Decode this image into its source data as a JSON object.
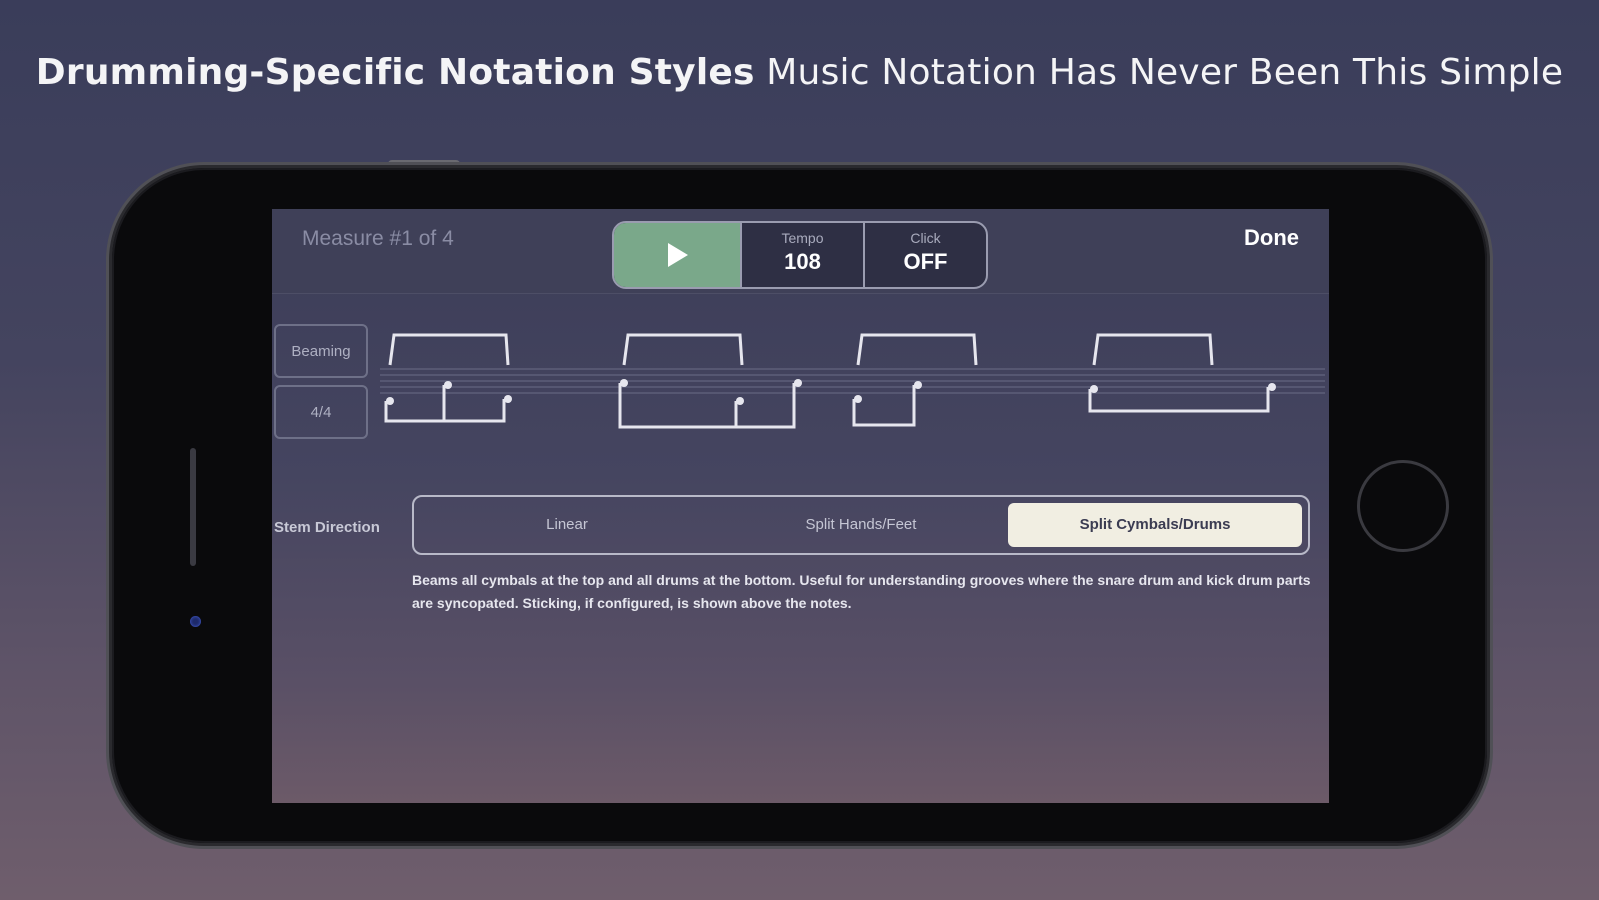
{
  "headline": {
    "bold": "Drumming-Specific Notation Styles",
    "rest": "Music Notation Has Never Been This Simple"
  },
  "app": {
    "measure_label": "Measure #1 of 4",
    "done_label": "Done",
    "transport": {
      "play_icon": "play-icon",
      "tempo_label": "Tempo",
      "tempo_value": "108",
      "click_label": "Click",
      "click_value": "OFF"
    },
    "side_buttons": {
      "beaming": "Beaming",
      "time_signature": "4/4"
    },
    "stem_direction": {
      "label": "Stem Direction",
      "options": [
        "Linear",
        "Split Hands/Feet",
        "Split Cymbals/Drums"
      ],
      "selected": "Split Cymbals/Drums"
    },
    "description": "Beams all cymbals at the top and all drums at the bottom. Useful for understanding grooves where the snare drum and kick drum parts are syncopated. Sticking, if configured, is shown above the notes."
  },
  "colors": {
    "play_button": "#7aa88a",
    "selected_segment": "#f1eee2"
  }
}
